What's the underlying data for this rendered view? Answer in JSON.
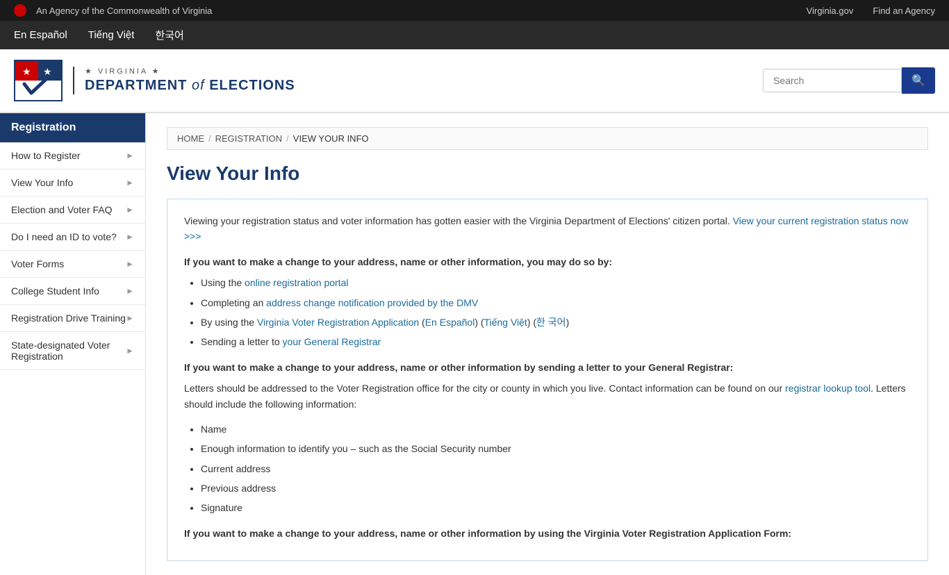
{
  "topbar": {
    "agency_text": "An Agency of the Commonwealth of Virginia",
    "link1": "Virginia.gov",
    "link2": "Find an Agency"
  },
  "languages": [
    {
      "label": "En Español",
      "href": "#"
    },
    {
      "label": "Tiếng Việt",
      "href": "#"
    },
    {
      "label": "한국어",
      "href": "#"
    }
  ],
  "header": {
    "logo_stars": "★  VIRGINIA  ★",
    "dept_line1": "DEPARTMENT",
    "dept_of": "of",
    "dept_line2": "ELECTIONS",
    "search_placeholder": "Search"
  },
  "sidebar": {
    "title": "Registration",
    "items": [
      {
        "label": "How to Register"
      },
      {
        "label": "View Your Info"
      },
      {
        "label": "Election and Voter FAQ"
      },
      {
        "label": "Do I need an ID to vote?"
      },
      {
        "label": "Voter Forms"
      },
      {
        "label": "College Student Info"
      },
      {
        "label": "Registration Drive Training"
      },
      {
        "label": "State-designated Voter Registration"
      }
    ]
  },
  "breadcrumb": {
    "home": "HOME",
    "registration": "REGISTRATION",
    "current": "VIEW YOUR INFO"
  },
  "page": {
    "title": "View Your Info",
    "intro": "Viewing your registration status and voter information has gotten easier with the Virginia Department of Elections' citizen portal.",
    "intro_link": "View your current registration status now >>>",
    "section1_bold": "If you want to make a change to your address, name or other information, you may do so by:",
    "bullets1": [
      {
        "text": "Using the ",
        "link": "online registration portal",
        "rest": ""
      },
      {
        "text": "Completing an ",
        "link": "address change notification provided by the DMV",
        "rest": ""
      },
      {
        "text": "By using the ",
        "link": "Virginia Voter Registration Application",
        "rest2": " (",
        "link2": "En Español",
        "rest3": ") (",
        "link3": "Tiếng Việt",
        "rest4": ") (",
        "link4": "한 국어",
        "rest5": ")"
      },
      {
        "text": "Sending a letter to ",
        "link": "your General Registrar",
        "rest": ""
      }
    ],
    "section2_bold": "If you want to make a change to your address, name or other information by sending a letter to your General Registrar:",
    "para2": "Letters should be addressed to the Voter Registration office for the city or county in which you live. Contact information can be found on our",
    "para2_link": "registrar lookup tool",
    "para2_end": ". Letters should include the following information:",
    "bullets2": [
      "Name",
      "Enough information to identify you – such as the Social Security number",
      "Current address",
      "Previous address",
      "Signature"
    ],
    "section3_bold": "If you want to make a change to your address, name or other information by using the Virginia Voter Registration Application Form:"
  }
}
